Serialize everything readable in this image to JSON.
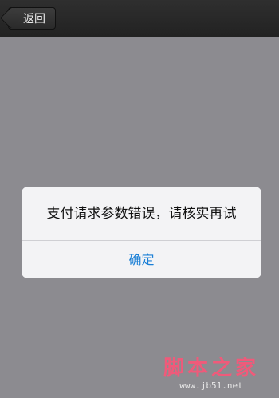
{
  "navbar": {
    "back_label": "返回"
  },
  "dialog": {
    "message": "支付请求参数错误，请核实再试",
    "confirm_label": "确定"
  },
  "watermark": {
    "title": "脚本之家",
    "url": "www.jb51.net"
  },
  "colors": {
    "background": "#8c8b90",
    "navbar": "#262626",
    "dialog": "#f3f3f5",
    "button_text": "#1a7fd6",
    "watermark": "#f05a7a"
  }
}
